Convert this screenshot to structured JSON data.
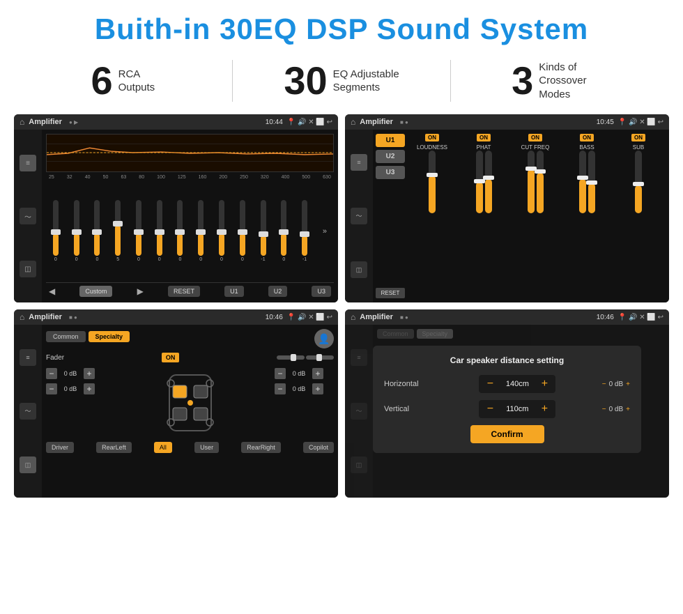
{
  "header": {
    "title": "Buith-in 30EQ DSP Sound System"
  },
  "stats": [
    {
      "number": "6",
      "label_line1": "RCA",
      "label_line2": "Outputs"
    },
    {
      "number": "30",
      "label_line1": "EQ Adjustable",
      "label_line2": "Segments"
    },
    {
      "number": "3",
      "label_line1": "Kinds of",
      "label_line2": "Crossover Modes"
    }
  ],
  "screens": {
    "screen1": {
      "app_name": "Amplifier",
      "time": "10:44",
      "freq_labels": [
        "25",
        "32",
        "40",
        "50",
        "63",
        "80",
        "100",
        "125",
        "160",
        "200",
        "250",
        "320",
        "400",
        "500",
        "630"
      ],
      "slider_values": [
        "0",
        "0",
        "0",
        "5",
        "0",
        "0",
        "0",
        "0",
        "0",
        "0",
        "-1",
        "0",
        "-1"
      ],
      "custom_label": "Custom",
      "reset_label": "RESET",
      "u1_label": "U1",
      "u2_label": "U2",
      "u3_label": "U3"
    },
    "screen2": {
      "app_name": "Amplifier",
      "time": "10:45",
      "u_buttons": [
        "U1",
        "U2",
        "U3"
      ],
      "channels": [
        {
          "name": "LOUDNESS",
          "on": true
        },
        {
          "name": "PHAT",
          "on": true
        },
        {
          "name": "CUT FREQ",
          "on": true
        },
        {
          "name": "BASS",
          "on": true
        },
        {
          "name": "SUB",
          "on": true
        }
      ],
      "reset_label": "RESET"
    },
    "screen3": {
      "app_name": "Amplifier",
      "time": "10:46",
      "tabs": [
        "Common",
        "Specialty"
      ],
      "fader_label": "Fader",
      "on_label": "ON",
      "db_values": [
        "0 dB",
        "0 dB",
        "0 dB",
        "0 dB"
      ],
      "bottom_buttons": [
        "Driver",
        "RearLeft",
        "All",
        "User",
        "RearRight",
        "Copilot"
      ]
    },
    "screen4": {
      "app_name": "Amplifier",
      "time": "10:46",
      "tabs": [
        "Common",
        "Specialty"
      ],
      "dialog": {
        "title": "Car speaker distance setting",
        "horizontal_label": "Horizontal",
        "horizontal_value": "140cm",
        "vertical_label": "Vertical",
        "vertical_value": "110cm",
        "confirm_label": "Confirm",
        "db_labels": [
          "0 dB",
          "0 dB"
        ]
      }
    }
  }
}
